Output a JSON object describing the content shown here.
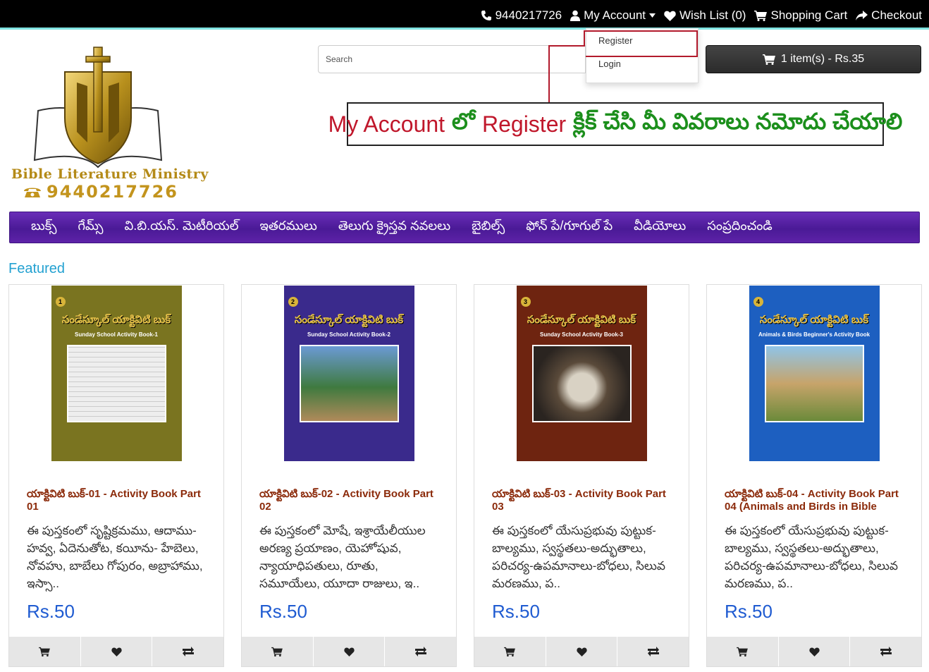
{
  "topbar": {
    "phone": "9440217726",
    "my_account": "My Account",
    "wishlist": "Wish List (0)",
    "shopping_cart": "Shopping Cart",
    "checkout": "Checkout"
  },
  "account_menu": {
    "register": "Register",
    "login": "Login"
  },
  "logo": {
    "title": "Bible Literature Ministry",
    "phone": "9440217726"
  },
  "search": {
    "placeholder": "Search"
  },
  "cart": {
    "summary": "1 item(s) - Rs.35"
  },
  "annotation": {
    "part1": "My Account",
    "part2": "లో",
    "part3": "Register",
    "part4": "క్లిక్ చేసి మీ వివరాలు నమోదు చేయాలి"
  },
  "nav": {
    "items": [
      "బుక్స్",
      "గేమ్స్",
      "వి.బి.యస్. మెటీరియల్",
      "ఇతరములు",
      "తెలుగు క్రైస్తవ నవలలు",
      "బైబిల్స్",
      "ఫోన్ పే/గూగుల్ పే",
      "వీడియోలు",
      "సంప్రదించండి"
    ]
  },
  "featured_heading": "Featured",
  "products": [
    {
      "name": "యాక్టివిటి బుక్-01 - Activity Book Part 01",
      "description": "ఈ పుస్తకంలో సృష్టిక్రమము, ఆదాము-హవ్వ, ఏదెనుతోట, కయీను- హేబెలు, నోవహు, బాబేలు గోపురం, అబ్రాహాము, ఇస్సా..",
      "price": "Rs.50",
      "cover_num": "1",
      "cover_title": "సండేస్కూల్ యాక్టివిటి బుక్",
      "cover_subtitle": "Sunday School Activity Book-1",
      "cover_color": "#7a7420"
    },
    {
      "name": "యాక్టివిటి బుక్-02 - Activity Book Part 02",
      "description": "ఈ పుస్తకంలో మోషే, ఇశ్రాయేలీయుల అరణ్య ప్రయాణం, యెహోషువ, న్యాయాధిపతులు, రూతు, సమూయేలు, యూదా రాజులు, ఇ..",
      "price": "Rs.50",
      "cover_num": "2",
      "cover_title": "సండేస్కూల్ యాక్టివిటి బుక్",
      "cover_subtitle": "Sunday School Activity Book-2",
      "cover_color": "#3a2a8c"
    },
    {
      "name": "యాక్టివిటి బుక్-03 - Activity Book Part 03",
      "description": "ఈ పుస్తకంలో యేసుప్రభువు పుట్టుక-బాల్యము, స్వస్థతలు-అద్భుతాలు, పరిచర్య-ఉపమానాలు-బోధలు, సిలువ మరణము, ప..",
      "price": "Rs.50",
      "cover_num": "3",
      "cover_title": "సండేస్కూల్ యాక్టివిటి బుక్",
      "cover_subtitle": "Sunday School Activity Book-3",
      "cover_color": "#6e2410"
    },
    {
      "name": "యాక్టివిటి బుక్-04 - Activity Book Part 04 (Animals and Birds in Bible",
      "description": "ఈ పుస్తకంలో యేసుప్రభువు పుట్టుక-బాల్యము, స్వస్థతలు-అద్భుతాలు, పరిచర్య-ఉపమానాలు-బోధలు, సిలువ మరణము, ప..",
      "price": "Rs.50",
      "cover_num": "4",
      "cover_title": "సండేస్కూల్ యాక్టివిటి బుక్",
      "cover_subtitle": "Animals & Birds Beginner's Activity Book",
      "cover_color": "#1d5fc0"
    }
  ],
  "colors": {
    "nav_purple": "#5a22a8",
    "featured_blue": "#23a1d1",
    "product_name": "#8b2a0a",
    "price_blue": "#1f5bd1",
    "annotation_red": "#c0172b",
    "annotation_green": "#1c8f1c"
  },
  "icons": {
    "phone": "phone-icon",
    "user": "user-icon",
    "heart": "heart-icon",
    "cart": "cart-icon",
    "checkout": "share-icon",
    "compare": "exchange-icon"
  }
}
